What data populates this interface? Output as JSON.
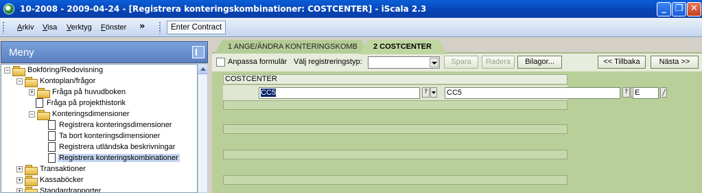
{
  "window": {
    "title": "10-2008 - 2009-04-24 - [Registrera konteringskombinationer: COSTCENTER] - iScala 2.3",
    "buttons": {
      "minimize": "_",
      "maximize": "❐",
      "close": "✕"
    }
  },
  "menubar": {
    "items": [
      "Arkiv",
      "Visa",
      "Verktyg",
      "Fönster"
    ],
    "overflow": "»",
    "enter_contract": "Enter Contract"
  },
  "sidebar": {
    "title": "Meny",
    "tree": [
      {
        "label": "Bokföring/Redovisning",
        "type": "folder",
        "expander": "−",
        "level": 0
      },
      {
        "label": "Kontoplan/frågor",
        "type": "folder",
        "expander": "−",
        "level": 1
      },
      {
        "label": "Fråga på huvudboken",
        "type": "folder",
        "expander": "+",
        "level": 2
      },
      {
        "label": "Fråga på projekthistorik",
        "type": "doc",
        "level": 2
      },
      {
        "label": "Konteringsdimensioner",
        "type": "folder",
        "expander": "−",
        "level": 2
      },
      {
        "label": "Registrera konteringsdimensioner",
        "type": "doc",
        "level": 3
      },
      {
        "label": "Ta bort konteringsdimensioner",
        "type": "doc",
        "level": 3
      },
      {
        "label": "Registrera utländska beskrivningar",
        "type": "doc",
        "level": 3
      },
      {
        "label": "Registrera konteringskombinationer",
        "type": "doc",
        "level": 3,
        "selected": true
      },
      {
        "label": "Transaktioner",
        "type": "folder",
        "expander": "+",
        "level": 1
      },
      {
        "label": "Kassaböcker",
        "type": "folder",
        "expander": "+",
        "level": 1
      },
      {
        "label": "Standardrapporter",
        "type": "folder",
        "expander": "+",
        "level": 1
      }
    ]
  },
  "tabs": [
    {
      "label": "1 ANGE/ÄNDRA KONTERINGSKOMB",
      "active": false
    },
    {
      "label": "2 COSTCENTER",
      "active": true
    }
  ],
  "toolbar": {
    "customize_label": "Anpassa formulär",
    "customize_checked": false,
    "regtype_label": "Välj registreringstyp:",
    "regtype_value": "",
    "save": "Spara",
    "delete": "Radera",
    "attachments": "Bilagor...",
    "back": "<< Tillbaka",
    "next": "Nästa >>"
  },
  "form": {
    "section_title": "COSTCENTER",
    "code_value": "CC5",
    "lookup_label": "?",
    "description_value": "CC5",
    "flag_value": "E",
    "empty_rows": 4
  },
  "colors": {
    "title_bar": "#0843b4",
    "form_background": "#b9cf9a",
    "active_tab": "#c0d6a0",
    "selection": "#0a246a"
  }
}
